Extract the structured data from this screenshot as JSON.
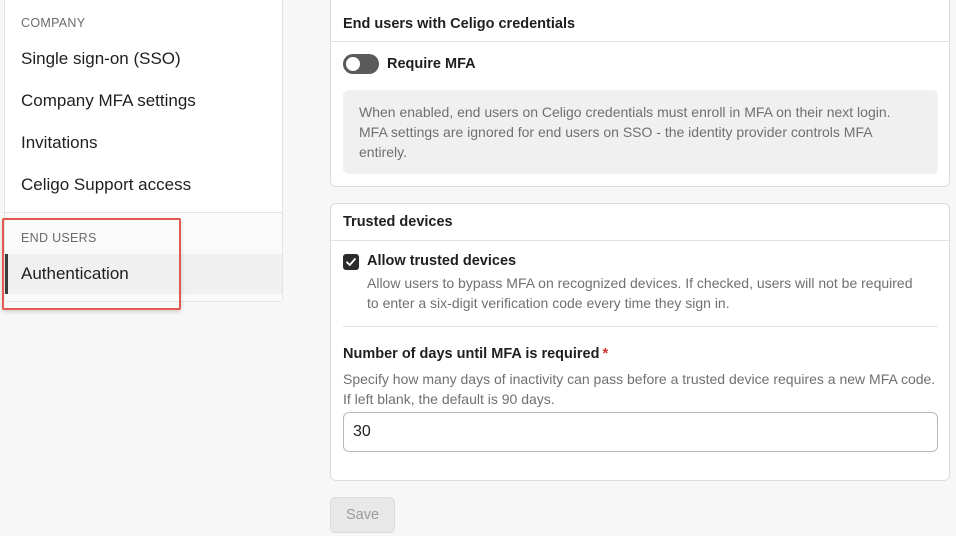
{
  "sidebar": {
    "company_label": "COMPANY",
    "company_items": [
      {
        "label": "Single sign-on (SSO)"
      },
      {
        "label": "Company MFA settings"
      },
      {
        "label": "Invitations"
      },
      {
        "label": "Celigo Support access"
      }
    ],
    "end_users_label": "END USERS",
    "active_item": "Authentication"
  },
  "mfa_card": {
    "title": "End users with Celigo credentials",
    "toggle_label": "Require MFA",
    "toggle_on": false,
    "info": "When enabled, end users on Celigo credentials must enroll in MFA on their next login. MFA settings are ignored for end users on SSO - the identity provider controls MFA entirely."
  },
  "trusted_card": {
    "title": "Trusted devices",
    "checkbox_label": "Allow trusted devices",
    "checkbox_checked": true,
    "checkbox_desc": "Allow users to bypass MFA on recognized devices. If checked, users will not be required to enter a six-digit verification code every time they sign in.",
    "field_label": "Number of days until MFA is required",
    "required_mark": "*",
    "field_help": "Specify how many days of inactivity can pass before a trusted device requires a new MFA code. If left blank, the default is 90 days.",
    "field_value": "30"
  },
  "save_label": "Save",
  "colors": {
    "highlight": "#e05a4f",
    "required": "#d0312d",
    "toggle_off": "#5a5a5a",
    "checkbox": "#2b2b2b"
  }
}
